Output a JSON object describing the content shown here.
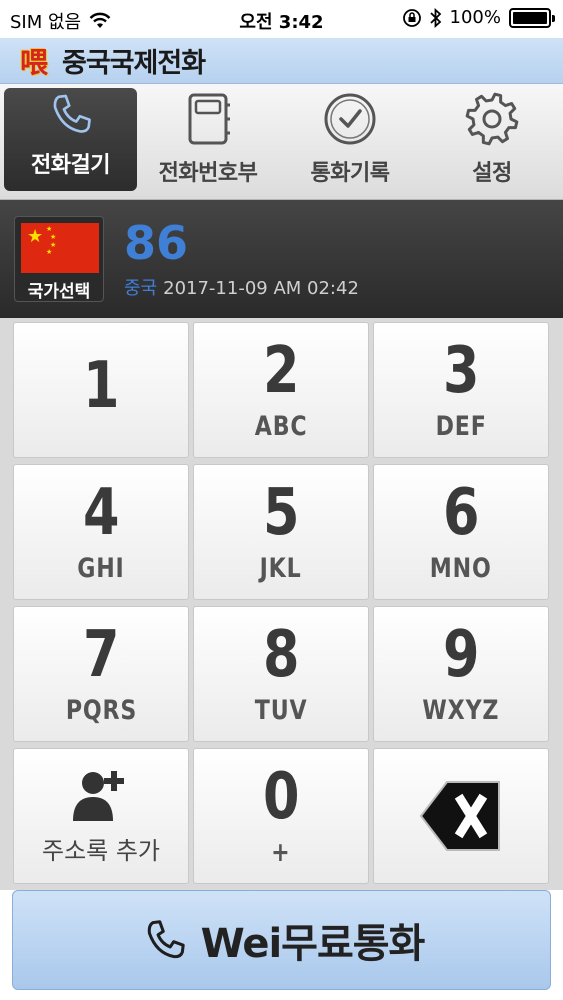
{
  "status_bar": {
    "carrier": "SIM 없음",
    "time": "오전 3:42",
    "battery": "100%",
    "battery_level": 1.0
  },
  "header": {
    "logo_text": "喂",
    "title": "중국국제전화"
  },
  "tabs": [
    {
      "label": "전화걸기",
      "icon": "phone-icon",
      "active": true
    },
    {
      "label": "전화번호부",
      "icon": "address-book-icon",
      "active": false
    },
    {
      "label": "통화기록",
      "icon": "clock-icon",
      "active": false
    },
    {
      "label": "설정",
      "icon": "gear-icon",
      "active": false
    }
  ],
  "country": {
    "select_label": "국가선택",
    "code": "86",
    "name": "중국",
    "datetime": "2017-11-09 AM 02:42",
    "flag": "china-flag-icon",
    "accent_color": "#3f7fd6"
  },
  "keypad": {
    "keys": [
      {
        "num": "1",
        "sub": ""
      },
      {
        "num": "2",
        "sub": "ABC"
      },
      {
        "num": "3",
        "sub": "DEF"
      },
      {
        "num": "4",
        "sub": "GHI"
      },
      {
        "num": "5",
        "sub": "JKL"
      },
      {
        "num": "6",
        "sub": "MNO"
      },
      {
        "num": "7",
        "sub": "PQRS"
      },
      {
        "num": "8",
        "sub": "TUV"
      },
      {
        "num": "9",
        "sub": "WXYZ"
      }
    ],
    "add_contact_label": "주소록 추가",
    "zero": {
      "num": "0",
      "sub": "+"
    },
    "delete_icon": "backspace-icon"
  },
  "call_button": {
    "label": "Wei무료통화",
    "icon": "phone-icon"
  }
}
